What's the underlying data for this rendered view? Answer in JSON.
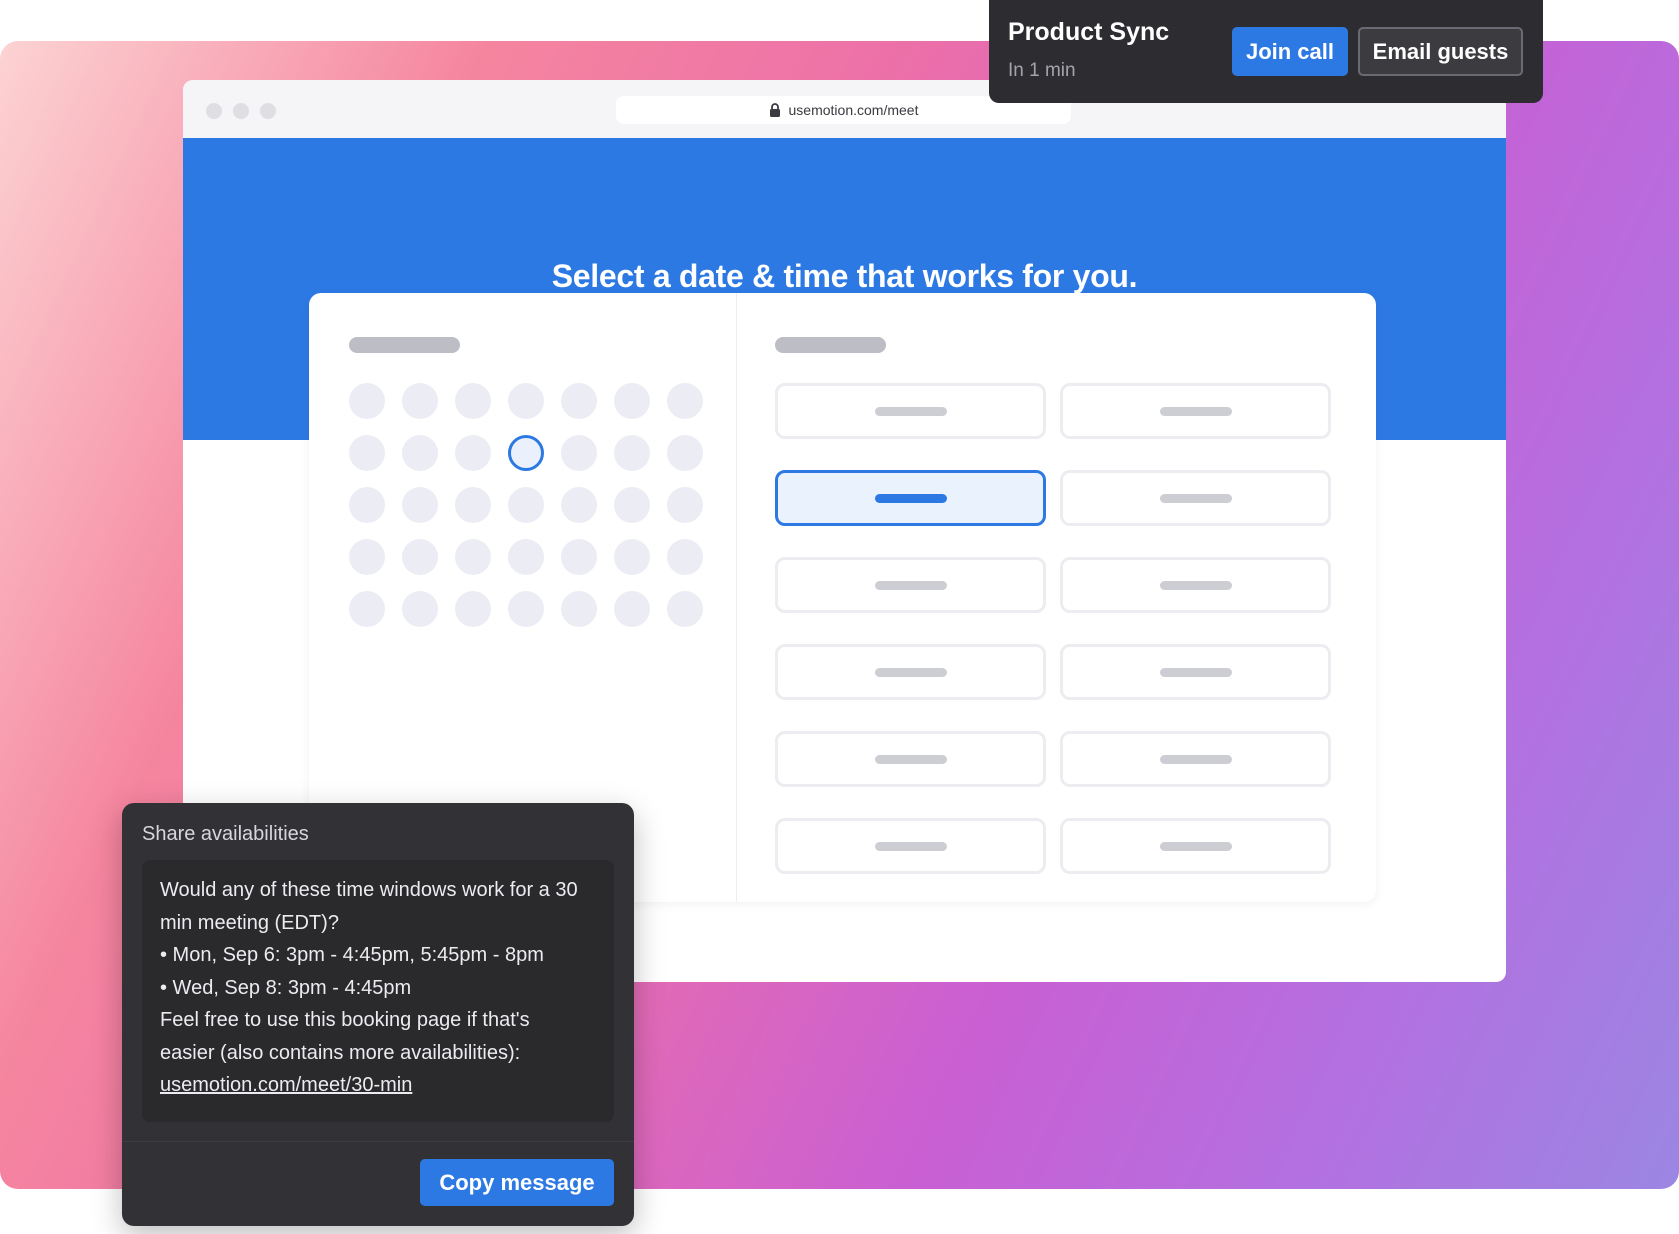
{
  "browser": {
    "url": "usemotion.com/meet"
  },
  "booking": {
    "title": "Select a date & time that works for you."
  },
  "toast": {
    "title": "Product Sync",
    "subtitle": "In 1 min",
    "join_label": "Join call",
    "email_label": "Email guests"
  },
  "share": {
    "title": "Share availabilities",
    "lines": [
      "Would any of these time windows work for a 30",
      "min meeting (EDT)?",
      "• Mon, Sep 6: 3pm - 4:45pm, 5:45pm - 8pm",
      "• Wed, Sep 8: 3pm - 4:45pm",
      "Feel free to use this booking page if that's",
      "easier (also contains more availabilities):"
    ],
    "link": "usemotion.com/meet/30-min",
    "copy_label": "Copy message"
  },
  "colors": {
    "accent": "#2d79e4",
    "panel_dark": "#323236",
    "toast_dark": "#2d2d31"
  }
}
